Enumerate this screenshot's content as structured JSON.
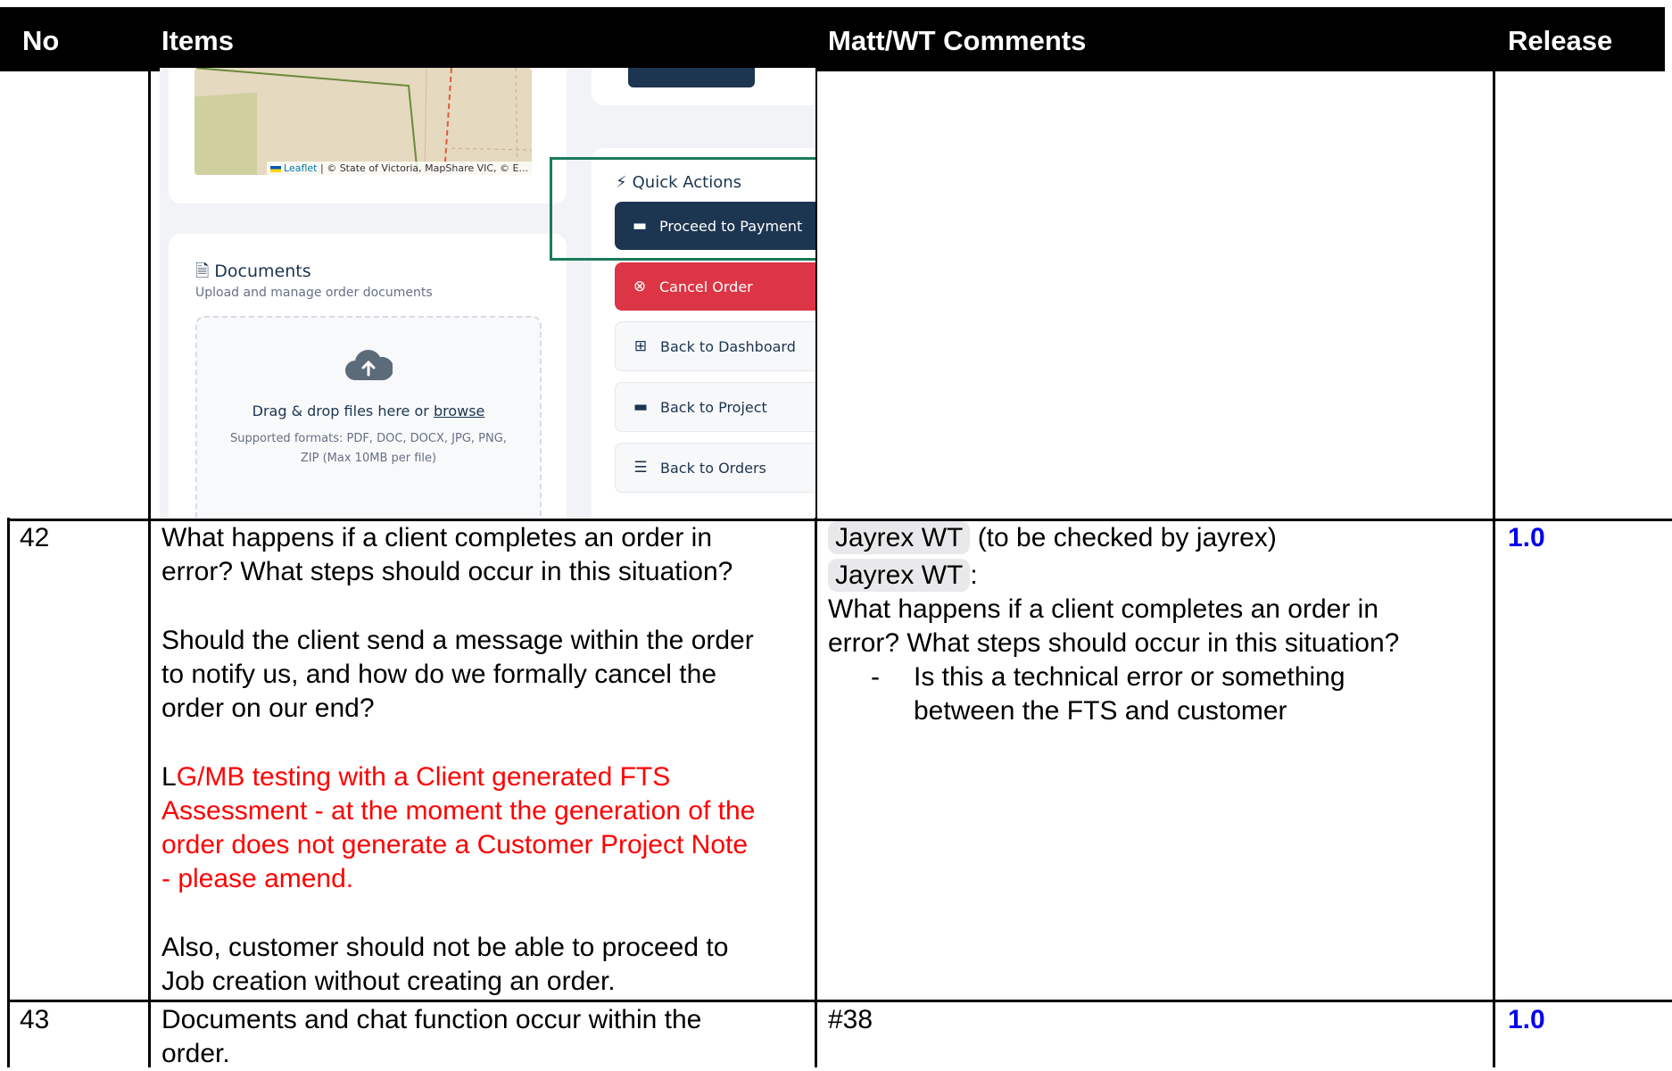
{
  "header": {
    "no": "No",
    "items": "Items",
    "comments": "Matt/WT Comments",
    "release": "Release"
  },
  "screenshot": {
    "map_attribution_link": "Leaflet",
    "map_attribution_text": "| © State of Victoria, MapShare VIC, © E...",
    "quick_actions_title": "Quick Actions",
    "proceed_label": "Proceed to Payment",
    "cancel_label": "Cancel Order",
    "dashboard_label": "Back to Dashboard",
    "project_label": "Back to Project",
    "orders_label": "Back to Orders",
    "documents_title": "Documents",
    "documents_subtitle": "Upload and manage order documents",
    "drop_text": "Drag & drop files here or",
    "browse_link": "browse",
    "formats_line1": "Supported formats: PDF, DOC, DOCX, JPG, PNG,",
    "formats_line2": "ZIP (Max 10MB per file)"
  },
  "rows": [
    {
      "no": "42",
      "item_p1_l1": "What happens if a client completes an order in",
      "item_p1_l2": "error? What steps should occur in this situation?",
      "item_p2_l1": "Should the client send a message within the order",
      "item_p2_l2": "to notify us, and how do we formally cancel the",
      "item_p2_l3": "order on our end?",
      "item_red_prefix": "L",
      "item_red_l1": "G/MB testing with a Client generated FTS",
      "item_red_l2": "Assessment - at the moment the generation of the",
      "item_red_l3": "order does not generate a Customer Project Note",
      "item_red_l4": "- please amend.",
      "item_p4_l1": "Also, customer should not be able to proceed to",
      "item_p4_l2": "Job creation without creating an order.",
      "comment_chip1": "Jayrex WT",
      "comment_note1": "(to be checked by jayrex)",
      "comment_chip2": "Jayrex WT",
      "comment_colon": ":",
      "comment_l1": "What happens if a client completes an order in",
      "comment_l2": "error? What steps should occur in this situation?",
      "comment_bullet": "-",
      "comment_b1": "Is this a technical error or something",
      "comment_b2": "between the FTS and customer",
      "release": "1.0"
    },
    {
      "no": "43",
      "item_l1": "Documents and chat function occur within the",
      "item_l2": "order.",
      "comment": "#38",
      "release": "1.0"
    }
  ],
  "colors": {
    "header_bg": "#000000",
    "release_blue": "#0000ee",
    "red_text": "#ff0000",
    "cancel_btn": "#dc3545",
    "primary_btn": "#1c3550",
    "highlight_box": "#1a7a5a"
  }
}
